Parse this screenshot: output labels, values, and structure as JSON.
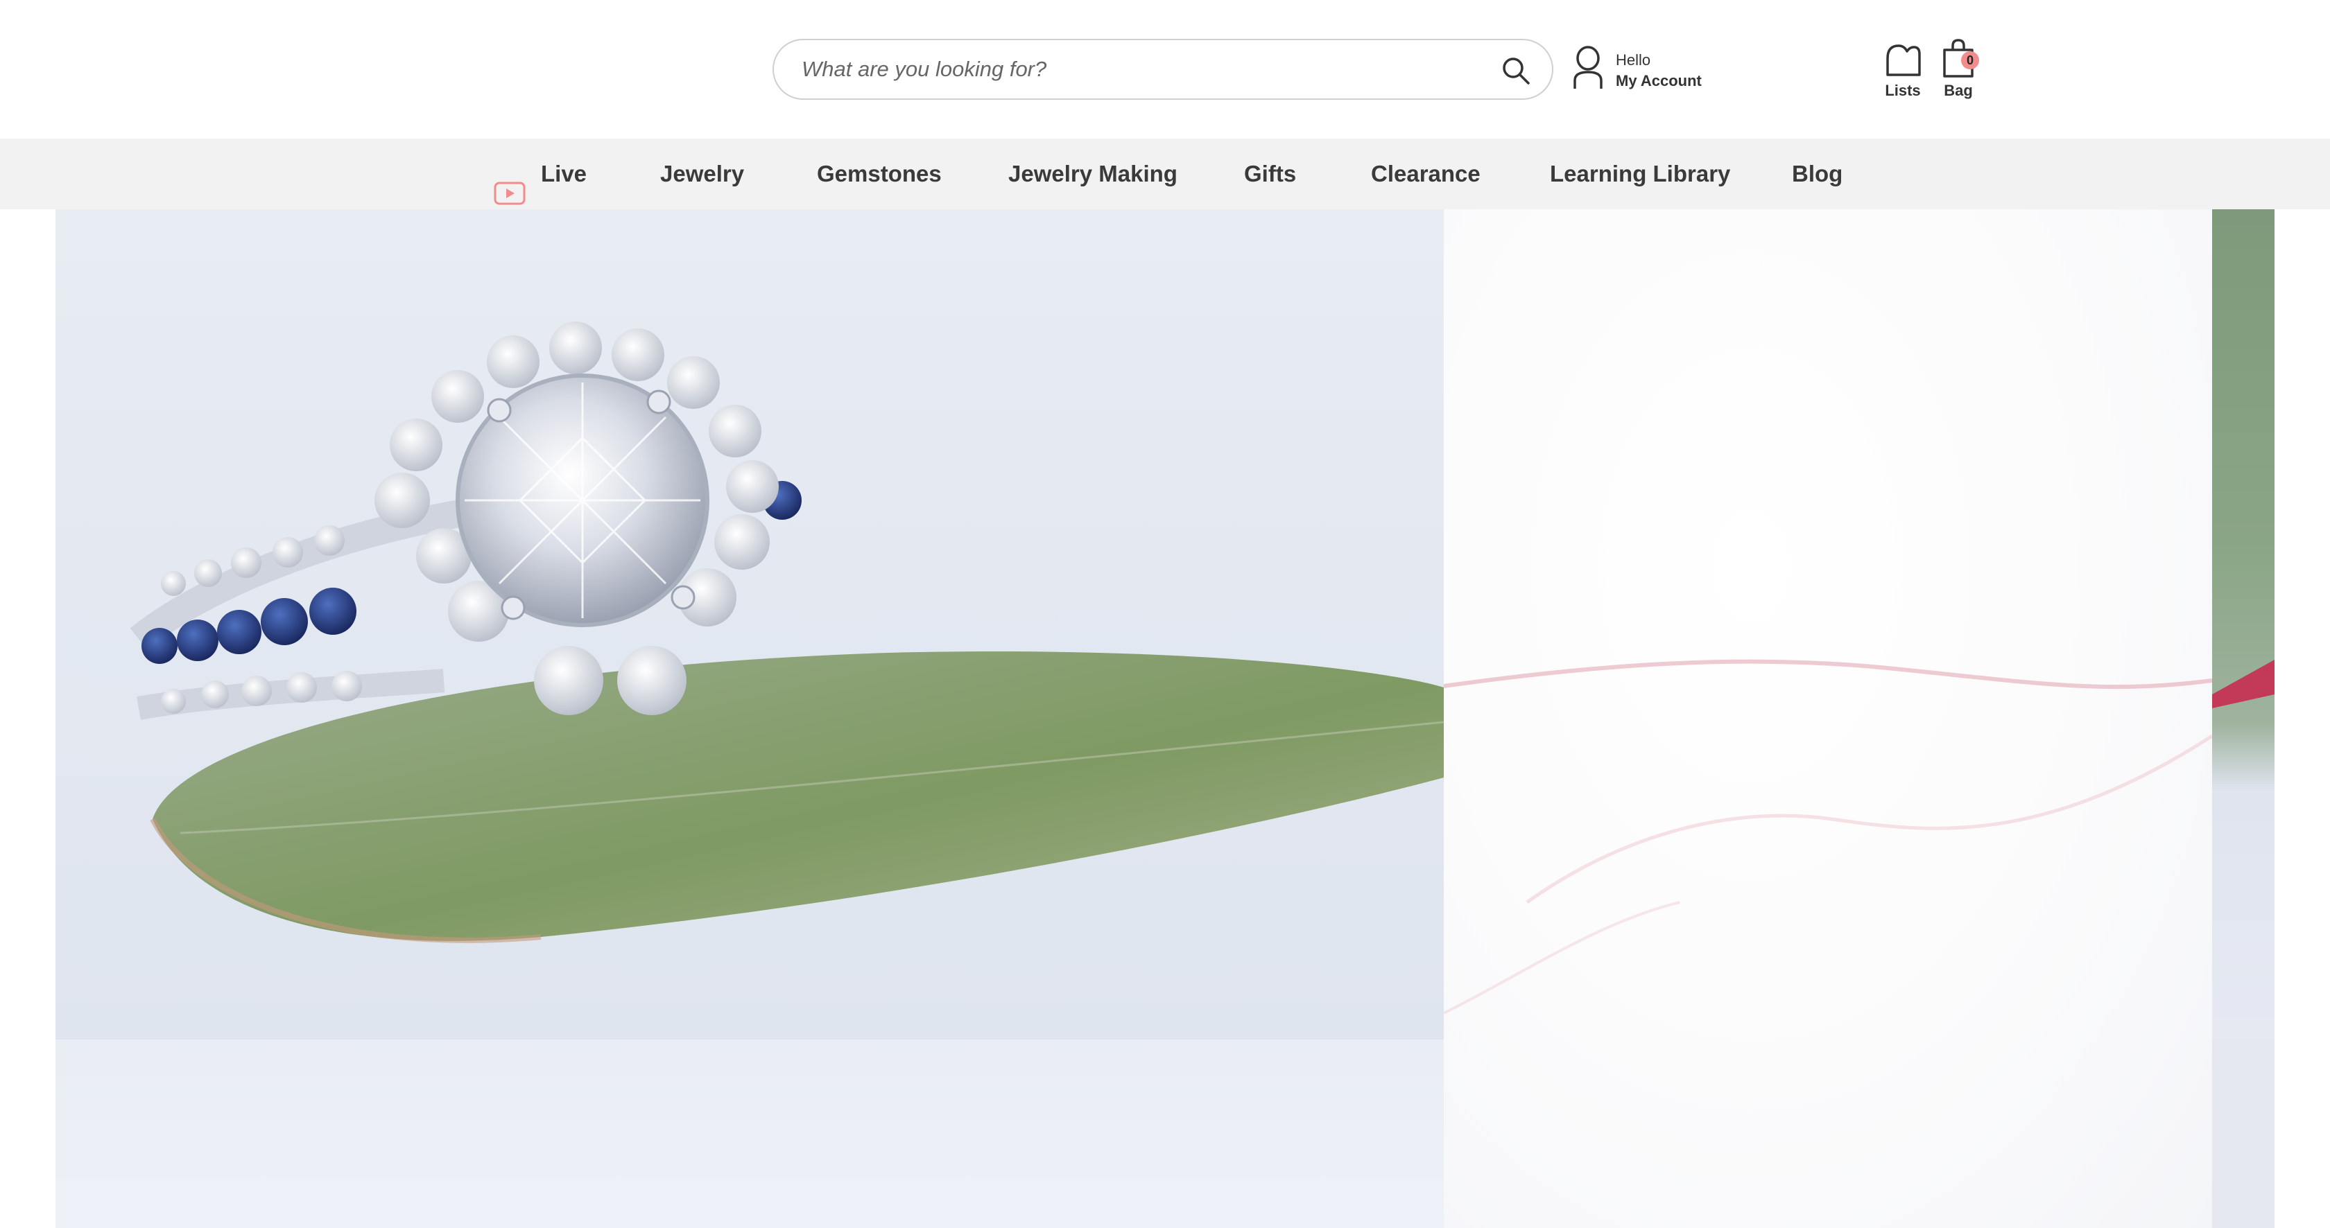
{
  "header": {
    "search": {
      "placeholder": "What are you looking for?",
      "value": ""
    },
    "account": {
      "greeting": "Hello",
      "label": "My Account"
    },
    "lists": {
      "label": "Lists"
    },
    "bag": {
      "label": "Bag",
      "count": "0"
    }
  },
  "nav": {
    "items": [
      {
        "label": "Live",
        "icon": "play-icon"
      },
      {
        "label": "Jewelry"
      },
      {
        "label": "Gemstones"
      },
      {
        "label": "Jewelry Making"
      },
      {
        "label": "Gifts"
      },
      {
        "label": "Clearance"
      },
      {
        "label": "Learning Library"
      },
      {
        "label": "Blog"
      }
    ]
  },
  "colors": {
    "accent": "#f28b8b",
    "nav_background": "#f2f2f2",
    "text": "#333333"
  }
}
